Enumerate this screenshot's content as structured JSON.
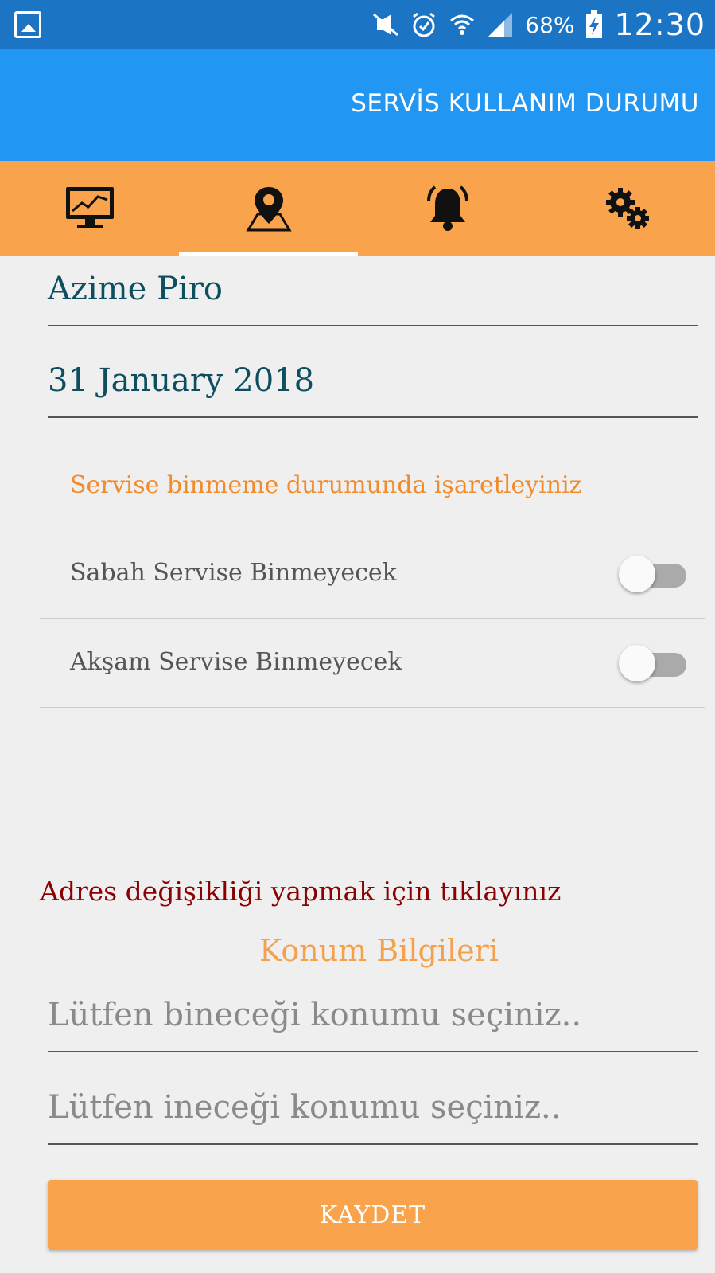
{
  "status_bar": {
    "battery_percent": "68%",
    "time": "12:30"
  },
  "app_bar": {
    "title": "SERVİS KULLANIM DURUMU"
  },
  "tabs": [
    {
      "icon": "monitor-chart-icon"
    },
    {
      "icon": "map-pin-icon",
      "selected": true
    },
    {
      "icon": "bell-icon"
    },
    {
      "icon": "gears-icon"
    }
  ],
  "form": {
    "name": "Azime  Piro",
    "date": "31 January 2018",
    "instruction": "Servise binmeme durumunda işaretleyiniz",
    "switches": [
      {
        "label": "Sabah Servise Binmeyecek",
        "on": false
      },
      {
        "label": "Akşam Servise Binmeyecek",
        "on": false
      }
    ],
    "address_link": "Adres değişikliği yapmak için tıklayınız",
    "location_title": "Konum Bilgileri",
    "pickup_placeholder": "Lütfen bineceği konumu seçiniz..",
    "dropoff_placeholder": "Lütfen ineceği konumu seçiniz..",
    "save_label": "KAYDET"
  },
  "colors": {
    "status_bar": "#1c74c4",
    "app_bar": "#2196f3",
    "accent_orange": "#f9a44c",
    "link_red": "#8b0000",
    "text_teal": "#0d4f5f"
  }
}
